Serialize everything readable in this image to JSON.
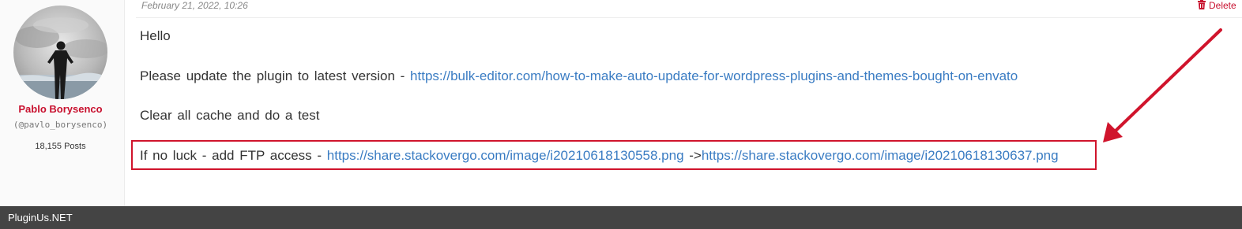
{
  "post": {
    "date": "February 21, 2022, 10:26",
    "delete_label": "Delete"
  },
  "author": {
    "name": "Pablo Borysenco",
    "handle": "(@pavlo_borysenco)",
    "posts": "18,155 Posts"
  },
  "message": {
    "greeting": "Hello",
    "update_text": "Please update the plugin to latest version - ",
    "update_link": "https://bulk-editor.com/how-to-make-auto-update-for-wordpress-plugins-and-themes-bought-on-envato",
    "cache_text": "Clear all cache and do a test",
    "ftp_text": "If no luck - add FTP access - ",
    "ftp_link_1": "https://share.stackovergo.com/image/i20210618130558.png",
    "ftp_arrow": " ->",
    "ftp_link_2": "https://share.stackovergo.com/image/i20210618130637.png"
  },
  "annotation": {
    "color": "#d0142c"
  },
  "footer": {
    "brand": "PluginUs.NET"
  }
}
